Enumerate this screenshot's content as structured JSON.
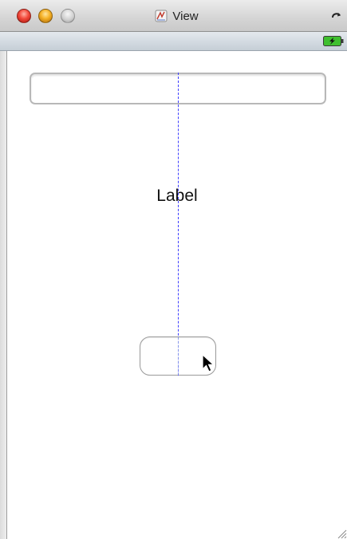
{
  "window": {
    "title": "View"
  },
  "content": {
    "label_text": "Label",
    "text_field_value": "",
    "button_label": ""
  },
  "icons": {
    "app": "instruments-app-icon",
    "rotate": "rotate-device-icon",
    "battery": "battery-charging-icon",
    "cursor": "mouse-pointer-icon",
    "resize": "resize-grip-icon"
  },
  "colors": {
    "guide_line": "#3d3dff",
    "close": "#f2483a",
    "minimize": "#f5b024",
    "battery_fill": "#3fbf2f"
  }
}
